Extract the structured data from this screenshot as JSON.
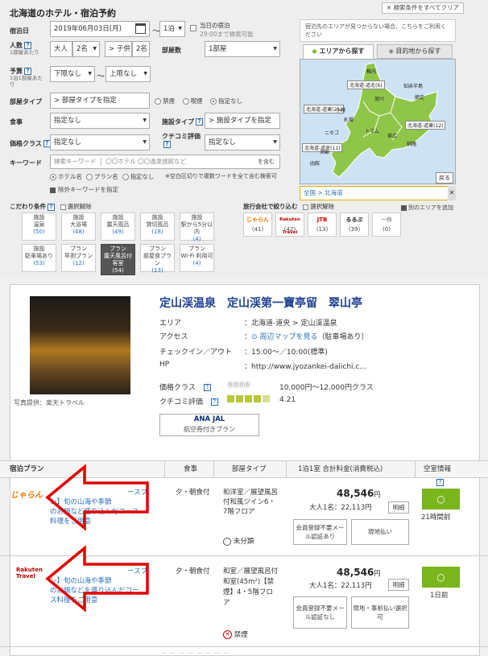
{
  "search": {
    "title": "北海道のホテル・宿泊予約",
    "clear_all": "✕ 検索条件をすべてクリア",
    "checkin_label": "宿泊日",
    "checkin_value": "2019年06月03日(月)",
    "nights_sep": "〜",
    "nights_value": "1泊",
    "today_label": "当日の宿泊",
    "today_sub": "29:00まで検索可能",
    "people_label": "人数",
    "people_sub": "1部屋あたり",
    "adults_value": "大人",
    "adults_count": "2名",
    "child_value": "> 子供",
    "child_count": "2名",
    "rooms_label": "部屋数",
    "rooms_value": "1部屋",
    "budget_label": "予算",
    "budget_sub": "1泊1部屋あたり",
    "budget_min": "下限なし",
    "budget_sep": "〜",
    "budget_max": "上限なし",
    "roomtype_label": "部屋タイプ",
    "roomtype_value": "> 部屋タイプを指定",
    "smoke_opts": [
      "禁煙",
      "喫煙",
      "指定なし"
    ],
    "meal_label": "食事",
    "meal_value": "指定なし",
    "facility_label": "施設タイプ",
    "facility_value": "> 施設タイプを指定",
    "priceclass_label": "価格クラス",
    "priceclass_value": "指定なし",
    "review_label": "クチコミ評価",
    "review_value": "指定なし",
    "keyword_label": "キーワード",
    "keyword_prefix": "検索キーワード",
    "keyword_placeholder": "〇〇ホテル 〇〇温泉旅館など",
    "keyword_contains": "を含む",
    "kw_opts": [
      "ホテル名",
      "プラン名",
      "指定なし"
    ],
    "kw_note": "※空白区切りで複数ワードを全て含む検索可",
    "exclude_kw": "除外キーワードを指定",
    "kodawari_label": "こだわり条件",
    "clear_sel": "選択解除",
    "facets": [
      {
        "t": "施設",
        "n": "温泉",
        "c": "(50)"
      },
      {
        "t": "施設",
        "n": "大浴場",
        "c": "(48)"
      },
      {
        "t": "施設",
        "n": "露天風呂",
        "c": "(49)"
      },
      {
        "t": "施設",
        "n": "貸切風呂",
        "c": "(18)"
      },
      {
        "t": "施設",
        "n": "駅から5分以内",
        "c": "(4)"
      },
      {
        "t": "施設",
        "n": "駐車場あり",
        "c": "(53)"
      },
      {
        "t": "プラン",
        "n": "早割プラン",
        "c": "(12)"
      },
      {
        "t": "プラン",
        "n": "露天風呂付客室",
        "c": "(54)"
      },
      {
        "t": "プラン",
        "n": "部屋食プラン",
        "c": "(13)"
      },
      {
        "t": "プラン",
        "n": "Wi-Fi 利用可",
        "c": "(4)"
      }
    ],
    "agent_label": "旅行会社で絞り込む",
    "agent_clear": "選択解除",
    "agents": [
      {
        "logo": "じゃらん",
        "c": "(41)",
        "color": "#f07800"
      },
      {
        "logo": "Rakuten Travel",
        "c": "(42)",
        "color": "#bf0000"
      },
      {
        "logo": "JTB",
        "c": "(13)",
        "color": "#d00000"
      },
      {
        "logo": "るるぶ",
        "c": "(39)",
        "color": "#222"
      },
      {
        "logo": "一休",
        "c": "(0)",
        "color": "#999"
      }
    ]
  },
  "map": {
    "hint": "宿泊先のエリアが見つからない場合、こちらをご利用ください",
    "tab_area": "エリアから探す",
    "tab_dest": "目的地から探す",
    "regions": [
      "稚内",
      "北海道-道北(6)",
      "北海道-道東(25)",
      "知床半島",
      "網走",
      "旭川",
      "小樽",
      "札幌",
      "北海道-道東(12)",
      "ニセコ",
      "トマム",
      "帯広",
      "釧路",
      "北海道-道央(11)",
      "洞爺",
      "函館",
      "戻る"
    ],
    "selected": "全国 > 北海道",
    "other_area": "別のエリアを追加"
  },
  "hotel": {
    "name": "定山渓温泉　定山渓第一寶亭留　翠山亭",
    "area_label": "エリア",
    "area_value": "：北海道-道央 > 定山渓温泉",
    "access_label": "アクセス",
    "access_map": "周辺マップを見る",
    "access_park": "（駐車場あり）",
    "checkin_label": "チェックイン／アウト",
    "checkin_value": "：15:00～／10:00(標準)",
    "hp_label": "HP",
    "hp_value": "：http://www.jyozankei-daiichi.c…",
    "price_label": "価格クラス",
    "price_value": "10,000円～12,000円クラス",
    "review_label": "クチコミ評価",
    "review_value": "4.21",
    "photo_credit": "写真提供：楽天トラベル",
    "ana_btn": "ANA JAL",
    "ana_sub": "航空券付きプラン"
  },
  "table": {
    "headers": [
      "宿泊プラン",
      "食事",
      "部屋タイプ",
      "1泊1室 合計料金(消費税込)",
      "空室情報"
    ],
    "rows": [
      {
        "agent": "じゃらん",
        "plan": "ースプ",
        "plan2": "ン】旬の山海や季節",
        "plan3": "のお鍋など盛り込んだコース",
        "plan4": "料理をご用意",
        "meal": "夕・朝食付",
        "room": "和洋室／展望風呂付和風ツイン6・7階フロア",
        "smoke": "未分類",
        "price": "48,546",
        "unit": "円",
        "per": "大人1名：22,113円",
        "tag": "明細",
        "b1": "会員登録不要メール認証あり",
        "b2": "現地払い",
        "avail": "○",
        "ago": "21時間前"
      },
      {
        "agent": "Rakuten Travel",
        "plan": "ースプ",
        "plan2": "ン】旬の山海や季節",
        "plan3": "のお鍋などを盛り込んだコー",
        "plan4": "ス料理をご用意",
        "meal": "夕・朝食付",
        "room": "和室／展望風呂付和室(45m²)【禁煙】4・5階フロア",
        "smoke": "禁煙",
        "price": "48,546",
        "unit": "円",
        "per": "大人1名：22,113円",
        "tag": "明細",
        "b1": "会員登録不要メール認証なし",
        "b2": "現地・事前払い選択可",
        "avail": "○",
        "ago": "1日前"
      }
    ]
  },
  "colors": {
    "accent": "#7ab51d",
    "link": "#1d3f94",
    "arrow": "#e00000"
  }
}
